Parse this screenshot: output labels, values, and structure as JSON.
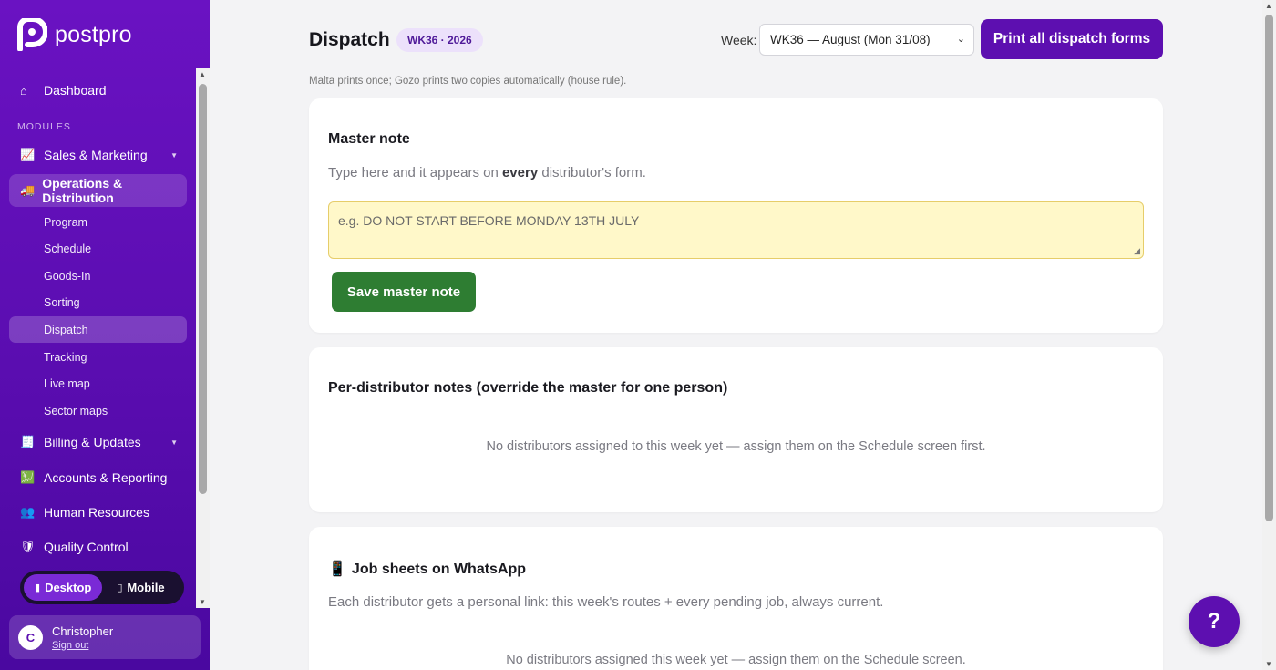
{
  "brand": {
    "name": "postpro"
  },
  "sidebar": {
    "dashboard": {
      "label": "Dashboard",
      "icon": "home-icon"
    },
    "section_label": "MODULES",
    "modules": [
      {
        "label": "Sales & Marketing",
        "icon": "chart-icon",
        "expandable": true
      },
      {
        "label": "Operations & Distribution",
        "icon": "truck-icon",
        "active": true
      },
      {
        "label": "Billing & Updates",
        "icon": "receipt-icon",
        "expandable": true
      },
      {
        "label": "Accounts & Reporting",
        "icon": "ledger-icon"
      },
      {
        "label": "Human Resources",
        "icon": "people-icon"
      },
      {
        "label": "Quality Control",
        "icon": "shield-icon"
      }
    ],
    "sub_items": [
      "Program",
      "Schedule",
      "Goods-In",
      "Sorting",
      "Dispatch",
      "Tracking",
      "Live map",
      "Sector maps"
    ],
    "active_sub": "Dispatch"
  },
  "view_toggle": {
    "desktop": "Desktop",
    "mobile": "Mobile",
    "selected": "Desktop"
  },
  "user": {
    "initial": "C",
    "name": "Christopher",
    "sign_out": "Sign out"
  },
  "header": {
    "title": "Dispatch",
    "badge": "WK36 · 2026",
    "week_label": "Week:",
    "week_value": "WK36 — August (Mon 31/08)",
    "print_button": "Print all dispatch forms",
    "hint": "Malta prints once; Gozo prints two copies automatically (house rule)."
  },
  "master_note": {
    "title": "Master note",
    "subtitle_pre": "Type here and it appears on ",
    "subtitle_bold": "every",
    "subtitle_post": " distributor's form.",
    "placeholder": "e.g. DO NOT START BEFORE MONDAY 13TH JULY",
    "save_button": "Save master note"
  },
  "per_distributor": {
    "title": "Per-distributor notes (override the master for one person)",
    "empty": "No distributors assigned to this week yet — assign them on the Schedule screen first."
  },
  "whatsapp": {
    "title": "Job sheets on WhatsApp",
    "icon": "phone-icon",
    "subtitle": "Each distributor gets a personal link: this week's routes + every pending job, always current.",
    "empty": "No distributors assigned this week yet — assign them on the Schedule screen."
  },
  "help_button": "?",
  "colors": {
    "brand": "#5d0fb0",
    "save": "#2e7d32",
    "note_bg": "#fff8c9"
  }
}
